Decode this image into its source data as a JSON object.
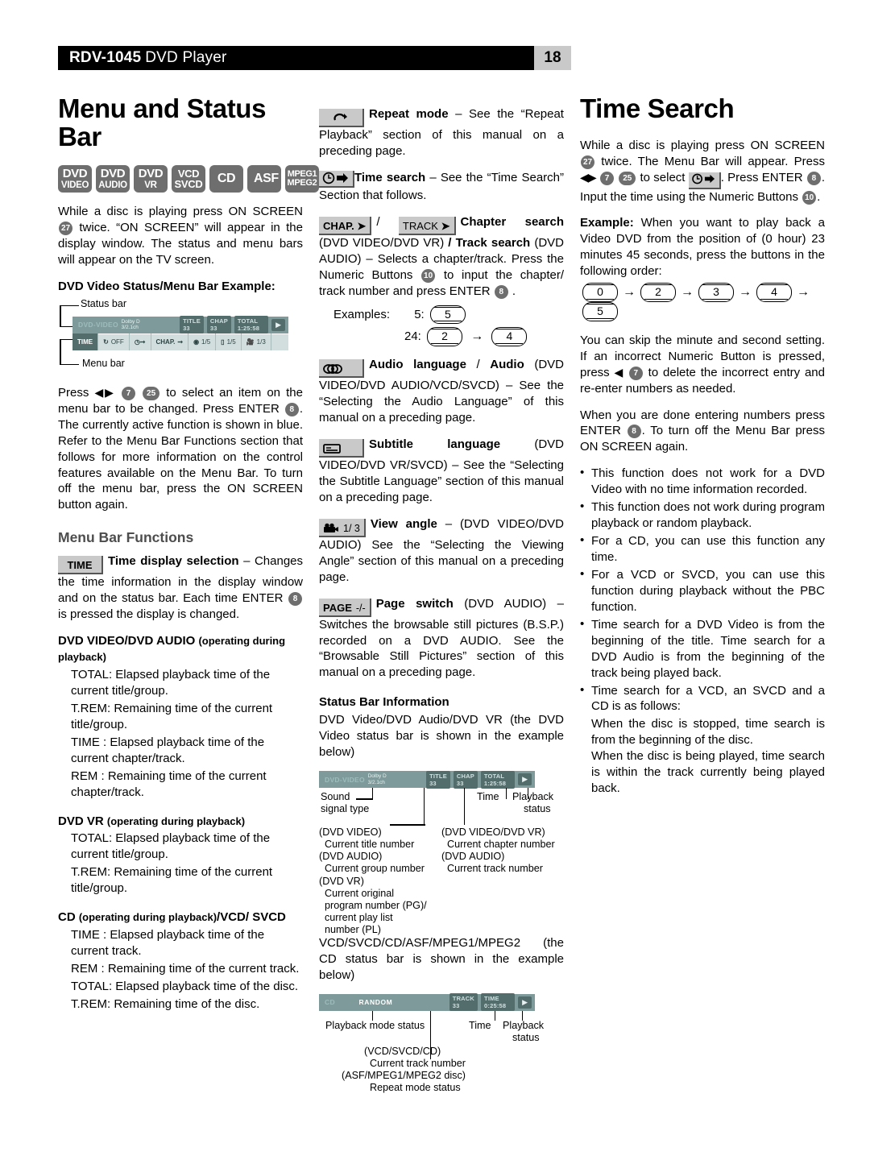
{
  "header": {
    "model": "RDV-1045",
    "product": "DVD Player",
    "page_number": "18"
  },
  "col1": {
    "title": "Menu and Status Bar",
    "formats": [
      {
        "line1": "DVD",
        "line2": "VIDEO"
      },
      {
        "line1": "DVD",
        "line2": "AUDIO"
      },
      {
        "line1": "DVD",
        "line2": "VR"
      },
      {
        "line1": "VCD",
        "line2": "SVCD"
      },
      {
        "line1": "CD",
        "line2": ""
      },
      {
        "line1": "ASF",
        "line2": ""
      },
      {
        "line1": "MPEG1",
        "line2": "MPEG2"
      }
    ],
    "intro_a": "While a disc is playing press ON SCREEN",
    "intro_key": "27",
    "intro_b": "twice. “ON SCREEN” will appear in the display window. The status and menu bars will appear on the TV screen.",
    "example_heading": "DVD Video Status/Menu Bar Example:",
    "label_status_bar": "Status bar",
    "label_menu_bar": "Menu bar",
    "osd": {
      "disc_type": "DVD-VIDEO",
      "dolby_l1": "Dolby D",
      "dolby_l2": "3/2.1ch",
      "title_chip": "TITLE 33",
      "chap_chip": "CHAP 33",
      "total_chip": "TOTAL   1:25:58",
      "menu_time": "TIME",
      "menu_repeat": "OFF",
      "menu_chap": "CHAP.",
      "menu_audio": "1/5",
      "menu_subtitle": "1/5",
      "menu_angle": "1/3"
    },
    "press_a": "Press",
    "press_keys": [
      "7",
      "25"
    ],
    "press_b": "to select an item on the menu bar to be changed. Press ENTER",
    "press_key_enter": "8",
    "press_c": ". The currently active function is shown in blue. Refer to the Menu Bar Functions section that follows for more information on the control features available on the Menu Bar. To turn off the menu bar, press the ON SCREEN button again.",
    "menu_bar_functions_heading": "Menu Bar Functions",
    "time_btn": "TIME",
    "time_title": "Time display selection",
    "time_body_a": "– Changes the time information in the display window and on the status bar. Each time ENTER",
    "time_key": "8",
    "time_body_b": "is pressed the display is changed.",
    "blocks": [
      {
        "head_bold": "DVD VIDEO/DVD AUDIO",
        "head_small": "(operating during playback)",
        "lines": [
          "TOTAL: Elapsed playback time of the current title/group.",
          "T.REM: Remaining time of the current title/group.",
          "TIME : Elapsed playback time of the current chapter/track.",
          "REM : Remaining time of the current chapter/track."
        ]
      },
      {
        "head_bold": "DVD VR",
        "head_small": "(operating during playback)",
        "lines": [
          "TOTAL: Elapsed playback time of the current title/group.",
          "T.REM: Remaining time of the current title/group."
        ]
      },
      {
        "head_bold": "CD",
        "head_small": "(operating during playback)",
        "head_bold2": "/VCD/ SVCD",
        "lines": [
          "TIME : Elapsed playback time of the current track.",
          "REM : Remaining time of the current track.",
          "TOTAL: Elapsed playback time of the disc.",
          "T.REM: Remaining time of the disc."
        ]
      }
    ]
  },
  "col2": {
    "repeat": {
      "icon": "repeat-icon",
      "title": "Repeat mode",
      "body": "– See the “Repeat Playback” section of this manual on a preceding page."
    },
    "timesearch": {
      "icon": "clock-arrow-icon",
      "title": "Time search",
      "body": "– See the “Time Search” Section that follows."
    },
    "chapter": {
      "btn1": "CHAP.",
      "sep": "/",
      "btn2": "TRACK",
      "title1": "Chapter search",
      "mid1": "(DVD VIDEO/DVD VR)",
      "slash": "/",
      "title2": "Track search",
      "mid2": "(DVD AUDIO) – Selects a chapter/track. Press the Numeric Buttons",
      "key_numeric": "10",
      "mid3": "to input the chapter/ track number and press ENTER",
      "key_enter": "8",
      "examples_label": "Examples:",
      "ex1_label": "5:",
      "ex1_keys": [
        "5"
      ],
      "ex2_label": "24:",
      "ex2_keys": [
        "2",
        "4"
      ]
    },
    "audio": {
      "icon": "audio-channel-icon",
      "title1": "Audio language",
      "slash": "/",
      "title2": "Audio",
      "body": "(DVD VIDEO/DVD AUDIO/VCD/SVCD) – See the “Selecting the Audio Language” of this manual on a preceding page."
    },
    "subtitle": {
      "icon": "subtitle-icon",
      "title": "Subtitle language",
      "body": "(DVD VIDEO/DVD VR/SVCD) – See the “Selecting the Subtitle Language” section of this manual on a preceding page."
    },
    "angle": {
      "icon": "camera-icon",
      "btn_value": "1/ 3",
      "title": "View angle",
      "body": "– (DVD VIDEO/DVD AUDIO) See the “Selecting the Viewing Angle” section of this manual on a preceding page."
    },
    "page_switch": {
      "btn": "PAGE",
      "btn_value": "-/-",
      "title": "Page switch",
      "body": "(DVD AUDIO) – Switches the browsable still pictures (B.S.P.) recorded on a DVD AUDIO. See the “Browsable Still Pictures” section of this manual on a preceding page."
    },
    "status_info": {
      "heading": "Status Bar Information",
      "body": "DVD Video/DVD Audio/DVD VR (the DVD Video status bar is shown in the example below)",
      "osd": {
        "disc_type": "DVD-VIDEO",
        "dolby_l1": "Dolby D",
        "dolby_l2": "3/2.1ch",
        "title_chip": "TITLE 33",
        "chap_chip": "CHAP 33",
        "total_chip": "TOTAL   1:25:58"
      },
      "annotations": {
        "sound": "Sound\nsignal type",
        "time": "Time",
        "playback": "Playback\nstatus",
        "left_group": "(DVD VIDEO)\n  Current title number\n(DVD AUDIO)\n  Current group number\n(DVD VR)\n  Current original\n  program number (PG)/\n  current play list\n  number (PL)",
        "right_group": "(DVD VIDEO/DVD VR)\n  Current chapter number\n(DVD AUDIO)\n  Current track number"
      }
    },
    "cd_status": {
      "body": "VCD/SVCD/CD/ASF/MPEG1/MPEG2 (the CD status bar is shown in the example below)",
      "osd": {
        "disc_type": "CD",
        "mode": "RANDOM",
        "track_chip": "TRACK 33",
        "time_chip": "TIME    0:25:58"
      },
      "annotations": {
        "playback_mode": "Playback mode status",
        "time": "Time",
        "playback": "Playback\nstatus",
        "track_group": "(VCD/SVCD/CD)\n  Current track number\n(ASF/MPEG1/MPEG2 disc)\n  Repeat mode status"
      }
    }
  },
  "col3": {
    "title": "Time Search",
    "p1_a": "While a disc is playing press ON SCREEN",
    "p1_key1": "27",
    "p1_b": "twice. The Menu Bar will appear. Press",
    "p1_key2": "7",
    "p1_key3": "25",
    "p1_c": "to select",
    "p1_d": ". Press ENTER",
    "p1_key4": "8",
    "p1_e": ". Input the time using the Numeric Buttons",
    "p1_key5": "10",
    "p1_f": ".",
    "example_label": "Example:",
    "example_body": "When you want to play back a Video DVD from the position of (0 hour) 23 minutes 45 seconds, press the buttons in the following order:",
    "example_keys": [
      "0",
      "2",
      "3",
      "4",
      "5"
    ],
    "p2_a": "You can skip the minute and second setting. If an incorrect Numeric Button is pressed, press",
    "p2_key": "7",
    "p2_b": "to delete the incorrect entry and re-enter numbers as needed.",
    "p3_a": "When you are done entering numbers press ENTER",
    "p3_key": "8",
    "p3_b": ". To turn off the Menu Bar press ON SCREEN again.",
    "bullets": [
      "This function does not work for a DVD Video with no time information recorded.",
      "This function does not work during program playback or random playback.",
      "For a CD, you can use this function any time.",
      "For a VCD or SVCD, you can use this function during playback without the PBC function.",
      "Time search for a DVD Video is from the beginning of the title. Time search for a DVD Audio is from the beginning of the track being played back.",
      "Time search for a VCD, an SVCD and a CD is as follows:"
    ],
    "tail1": "When the disc is stopped, time search is from the beginning of the disc.",
    "tail2": "When the disc is being played, time search is within the track currently being played back."
  },
  "colors": {
    "header_bar": "#000000",
    "page_number_bg": "#c9c9c9",
    "format_chip": "#6e6e6e",
    "osd_status_bg": "#7f9a9a",
    "osd_menu_bg": "#d2dede",
    "osd_selected": "#536c6c",
    "subhead_gray": "#4d4d4d"
  }
}
